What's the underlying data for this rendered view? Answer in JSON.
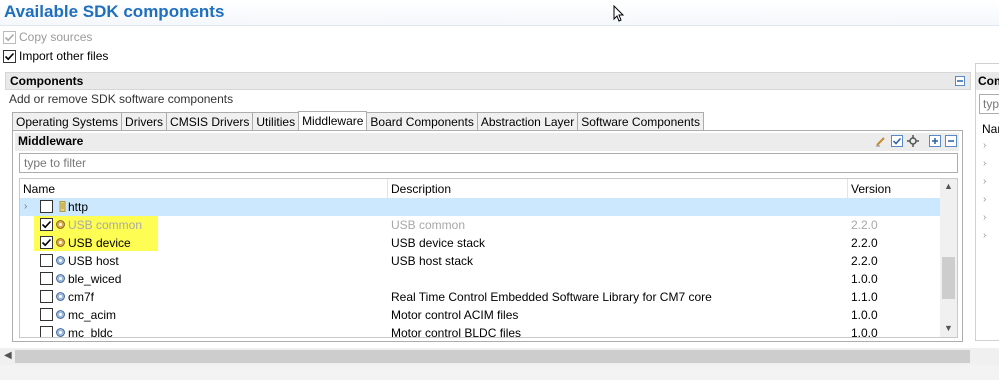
{
  "page": {
    "title": "Available SDK components"
  },
  "options": {
    "copy_sources": {
      "label": "Copy sources",
      "checked": true,
      "enabled": false
    },
    "import_other_files": {
      "label": "Import other files",
      "checked": true,
      "enabled": true
    }
  },
  "components_panel": {
    "title": "Components",
    "description": "Add or remove SDK software components",
    "tabs": [
      {
        "label": "Operating Systems",
        "active": false
      },
      {
        "label": "Drivers",
        "active": false
      },
      {
        "label": "CMSIS Drivers",
        "active": false
      },
      {
        "label": "Utilities",
        "active": false
      },
      {
        "label": "Middleware",
        "active": true
      },
      {
        "label": "Board Components",
        "active": false
      },
      {
        "label": "Abstraction Layer",
        "active": false
      },
      {
        "label": "Software Components",
        "active": false
      }
    ],
    "section_title": "Middleware",
    "filter_placeholder": "type to filter",
    "columns": {
      "name": "Name",
      "description": "Description",
      "version": "Version"
    },
    "rows": [
      {
        "name": "http",
        "description": "",
        "version": "",
        "checked": false,
        "expandable": true,
        "selected": true,
        "muted": false,
        "highlighted": false
      },
      {
        "name": "USB common",
        "description": "USB common",
        "version": "2.2.0",
        "checked": true,
        "expandable": false,
        "selected": false,
        "muted": true,
        "highlighted": true
      },
      {
        "name": "USB device",
        "description": "USB device stack",
        "version": "2.2.0",
        "checked": true,
        "expandable": false,
        "selected": false,
        "muted": false,
        "highlighted": true
      },
      {
        "name": "USB host",
        "description": "USB host stack",
        "version": "2.2.0",
        "checked": false,
        "expandable": false,
        "selected": false,
        "muted": false,
        "highlighted": false
      },
      {
        "name": "ble_wiced",
        "description": "",
        "version": "1.0.0",
        "checked": false,
        "expandable": false,
        "selected": false,
        "muted": false,
        "highlighted": false
      },
      {
        "name": "cm7f",
        "description": "Real Time Control Embedded Software Library for CM7 core",
        "version": "1.1.0",
        "checked": false,
        "expandable": false,
        "selected": false,
        "muted": false,
        "highlighted": false
      },
      {
        "name": "mc_acim",
        "description": "Motor control ACIM files",
        "version": "1.0.0",
        "checked": false,
        "expandable": false,
        "selected": false,
        "muted": false,
        "highlighted": false
      },
      {
        "name": "mc_bldc",
        "description": "Motor control BLDC files",
        "version": "1.0.0",
        "checked": false,
        "expandable": false,
        "selected": false,
        "muted": false,
        "highlighted": false
      }
    ]
  },
  "right_panel": {
    "title_fragment": "Com",
    "input_fragment": "typ",
    "header_fragment": "Nar"
  },
  "colors": {
    "title": "#1f6fbf",
    "selection": "#cce8ff",
    "highlight": "#fdfd54"
  }
}
